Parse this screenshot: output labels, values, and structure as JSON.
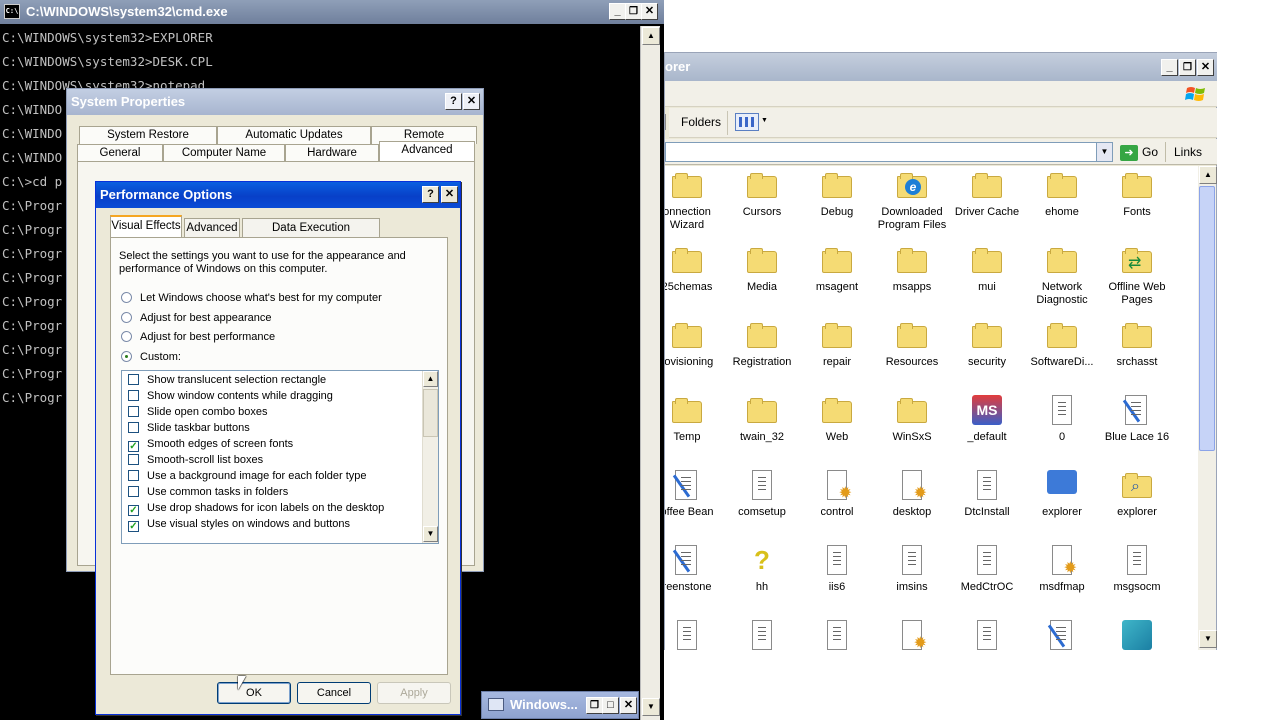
{
  "cmd": {
    "title": "C:\\WINDOWS\\system32\\cmd.exe",
    "icon_label": "C:\\",
    "lines": [
      "C:\\WINDOWS\\system32>EXPLORER",
      "C:\\WINDOWS\\system32>DESK.CPL",
      "C:\\WINDOWS\\system32>notepad",
      "C:\\WINDO",
      "C:\\WINDO",
      "C:\\WINDO",
      "C:\\>cd p",
      "C:\\Progr",
      "C:\\Progr",
      "C:\\Progr",
      "C:\\Progr",
      "C:\\Progr",
      "C:\\Progr",
      "C:\\Progr",
      "C:\\Progr",
      "C:\\Progr"
    ],
    "caption": {
      "minimize": "_",
      "restore": "❐",
      "close": "✕"
    }
  },
  "explorer": {
    "title": "orer",
    "toolbar": {
      "folders_label": "Folders",
      "views_icon": "views-icon"
    },
    "address": {
      "go_label": "Go",
      "links_label": "Links"
    },
    "items": [
      {
        "label": "onnection\nWizard",
        "type": "folder"
      },
      {
        "label": "Cursors",
        "type": "folder"
      },
      {
        "label": "Debug",
        "type": "folder"
      },
      {
        "label": "Downloaded\nProgram Files",
        "type": "ie-folder"
      },
      {
        "label": "Driver Cache",
        "type": "folder"
      },
      {
        "label": "ehome",
        "type": "folder"
      },
      {
        "label": "Fonts",
        "type": "folder"
      },
      {
        "label": "25chemas",
        "type": "folder"
      },
      {
        "label": "Media",
        "type": "folder"
      },
      {
        "label": "msagent",
        "type": "folder"
      },
      {
        "label": "msapps",
        "type": "folder"
      },
      {
        "label": "mui",
        "type": "folder"
      },
      {
        "label": "Network\nDiagnostic",
        "type": "folder"
      },
      {
        "label": "Offline Web\nPages",
        "type": "sync-folder"
      },
      {
        "label": "rovisioning",
        "type": "folder"
      },
      {
        "label": "Registration",
        "type": "folder"
      },
      {
        "label": "repair",
        "type": "folder"
      },
      {
        "label": "Resources",
        "type": "folder"
      },
      {
        "label": "security",
        "type": "folder"
      },
      {
        "label": "SoftwareDi...",
        "type": "folder"
      },
      {
        "label": "srchasst",
        "type": "folder"
      },
      {
        "label": "Temp",
        "type": "folder"
      },
      {
        "label": "twain_32",
        "type": "folder"
      },
      {
        "label": "Web",
        "type": "folder"
      },
      {
        "label": "WinSxS",
        "type": "folder"
      },
      {
        "label": "_default",
        "type": "ms-app"
      },
      {
        "label": "0",
        "type": "doc"
      },
      {
        "label": "Blue Lace 16",
        "type": "paint"
      },
      {
        "label": "offee Bean",
        "type": "paint"
      },
      {
        "label": "comsetup",
        "type": "doc"
      },
      {
        "label": "control",
        "type": "gear-doc"
      },
      {
        "label": "desktop",
        "type": "gear-doc"
      },
      {
        "label": "DtcInstall",
        "type": "doc"
      },
      {
        "label": "explorer",
        "type": "computer"
      },
      {
        "label": "explorer",
        "type": "search-folder"
      },
      {
        "label": "reenstone",
        "type": "paint"
      },
      {
        "label": "hh",
        "type": "help"
      },
      {
        "label": "iis6",
        "type": "doc"
      },
      {
        "label": "imsins",
        "type": "doc"
      },
      {
        "label": "MedCtrOC",
        "type": "doc"
      },
      {
        "label": "msdfmap",
        "type": "gear-doc"
      },
      {
        "label": "msgsocm",
        "type": "doc"
      },
      {
        "label": "",
        "type": "doc"
      },
      {
        "label": "",
        "type": "doc"
      },
      {
        "label": "",
        "type": "doc"
      },
      {
        "label": "",
        "type": "gear-doc"
      },
      {
        "label": "",
        "type": "doc"
      },
      {
        "label": "",
        "type": "paint"
      },
      {
        "label": "",
        "type": "cube"
      }
    ]
  },
  "system_properties": {
    "title": "System Properties",
    "tabs_top": [
      "System Restore",
      "Automatic Updates",
      "Remote"
    ],
    "tabs_bottom": [
      "General",
      "Computer Name",
      "Hardware",
      "Advanced"
    ]
  },
  "performance_options": {
    "title": "Performance Options",
    "tabs": [
      "Visual Effects",
      "Advanced",
      "Data Execution Prevention"
    ],
    "description": "Select the settings you want to use for the appearance and performance of Windows on this computer.",
    "radios": [
      {
        "label": "Let Windows choose what's best for my computer",
        "selected": false
      },
      {
        "label": "Adjust for best appearance",
        "selected": false
      },
      {
        "label": "Adjust for best performance",
        "selected": false
      },
      {
        "label": "Custom:",
        "selected": true
      }
    ],
    "effects": [
      {
        "label": "Show translucent selection rectangle",
        "checked": false
      },
      {
        "label": "Show window contents while dragging",
        "checked": false
      },
      {
        "label": "Slide open combo boxes",
        "checked": false
      },
      {
        "label": "Slide taskbar buttons",
        "checked": false
      },
      {
        "label": "Smooth edges of screen fonts",
        "checked": true
      },
      {
        "label": "Smooth-scroll list boxes",
        "checked": false
      },
      {
        "label": "Use a background image for each folder type",
        "checked": false
      },
      {
        "label": "Use common tasks in folders",
        "checked": false
      },
      {
        "label": "Use drop shadows for icon labels on the desktop",
        "checked": true
      },
      {
        "label": "Use visual styles on windows and buttons",
        "checked": true
      }
    ],
    "buttons": {
      "ok": "OK",
      "cancel": "Cancel",
      "apply": "Apply"
    }
  },
  "minimized_window": {
    "title": "Windows..."
  },
  "colors": {
    "active_title": "#0840c8",
    "inactive_title": "#a7b5cf",
    "checkmark": "#21a121",
    "folder": "#f5db74"
  }
}
